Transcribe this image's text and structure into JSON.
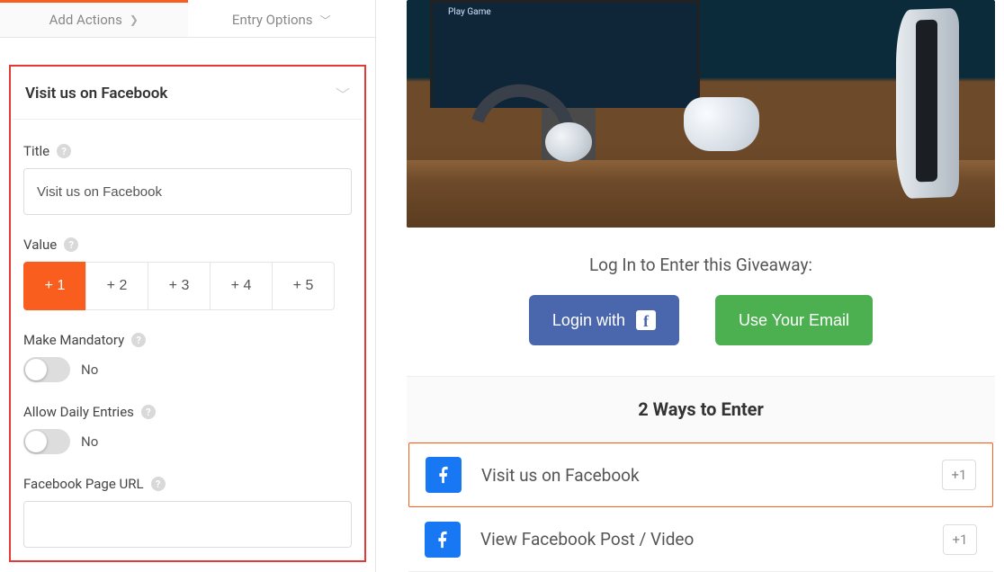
{
  "tabs": {
    "add_actions": "Add Actions",
    "entry_options": "Entry Options"
  },
  "section_title": "Visit us on Facebook",
  "fields": {
    "title": {
      "label": "Title",
      "value": "Visit us on Facebook"
    },
    "value": {
      "label": "Value",
      "options": [
        "+ 1",
        "+ 2",
        "+ 3",
        "+ 4",
        "+ 5"
      ],
      "selected_index": 0
    },
    "mandatory": {
      "label": "Make Mandatory",
      "state_text": "No"
    },
    "daily": {
      "label": "Allow Daily Entries",
      "state_text": "No"
    },
    "page_url": {
      "label": "Facebook Page URL",
      "value": ""
    }
  },
  "hero": {
    "play_label": "Play Game"
  },
  "login": {
    "title": "Log In to Enter this Giveaway:",
    "fb_button": "Login with",
    "email_button": "Use Your Email"
  },
  "ways": {
    "header": "2 Ways to Enter",
    "entries": [
      {
        "label": "Visit us on Facebook",
        "points": "+1"
      },
      {
        "label": "View Facebook Post / Video",
        "points": "+1"
      }
    ]
  }
}
